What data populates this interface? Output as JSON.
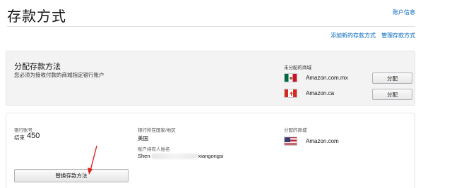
{
  "header": {
    "title": "存款方式",
    "account_link": "账户信息"
  },
  "actions": {
    "add_method": "添加新的存款方式",
    "manage_methods": "管理存款方式"
  },
  "assign_panel": {
    "title": "分配存款方法",
    "description": "您必须为接收付款的商城指定银行账户",
    "unassigned_label": "未分配的商城",
    "stores": [
      {
        "name": "Amazon.com.mx",
        "flag": "mexico-flag",
        "button_label": "分配"
      },
      {
        "name": "Amazon.ca",
        "flag": "canada-flag",
        "button_label": "分配"
      }
    ]
  },
  "bank_panel": {
    "account_label": "银行账号",
    "ending_label": "结束",
    "ending_digits": "450",
    "country_label": "银行所在国家/地区",
    "country_value": "美国",
    "holder_label": "账户持有人姓名",
    "holder_prefix": "Shen",
    "holder_suffix": "xiangongsi",
    "assigned_label": "分配的商城",
    "assigned_store": {
      "name": "Amazon.com",
      "flag": "usa-flag"
    },
    "replace_button": "替换存款方法"
  },
  "colors": {
    "link": "#0066c0",
    "panel_bg": "#f3f3f3",
    "arrow": "#e02020"
  }
}
